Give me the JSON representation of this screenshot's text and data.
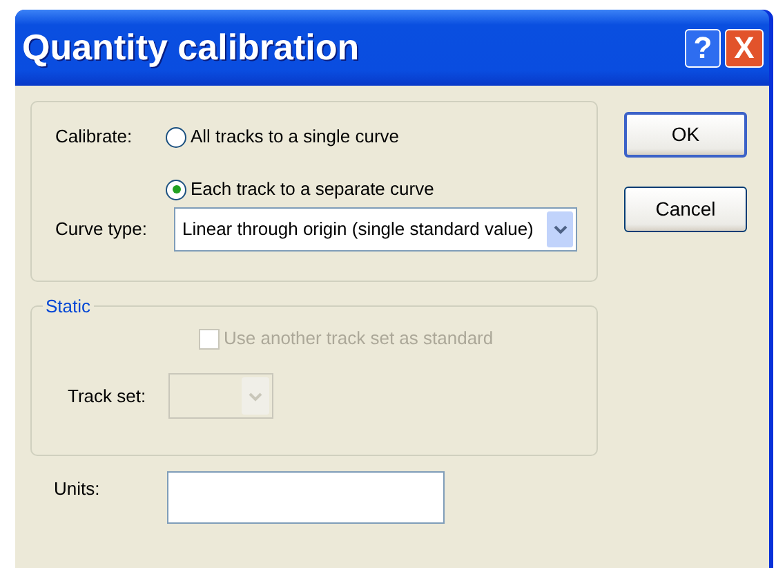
{
  "window": {
    "title": "Quantity calibration",
    "help_button": "?",
    "close_button": "X"
  },
  "calibrate": {
    "label": "Calibrate:",
    "options": [
      {
        "label": "All tracks to a single curve",
        "selected": false
      },
      {
        "label": "Each track to a separate curve",
        "selected": true
      }
    ]
  },
  "curve_type": {
    "label": "Curve type:",
    "value": "Linear through origin (single standard value)"
  },
  "static_group": {
    "title": "Static",
    "checkbox": {
      "label": "Use another track set as standard",
      "checked": false,
      "disabled": true
    },
    "track_set": {
      "label": "Track set:",
      "disabled": true
    }
  },
  "units": {
    "label": "Units:"
  },
  "buttons": [
    {
      "label": "OK",
      "default": true
    },
    {
      "label": "Cancel",
      "default": false
    }
  ]
}
